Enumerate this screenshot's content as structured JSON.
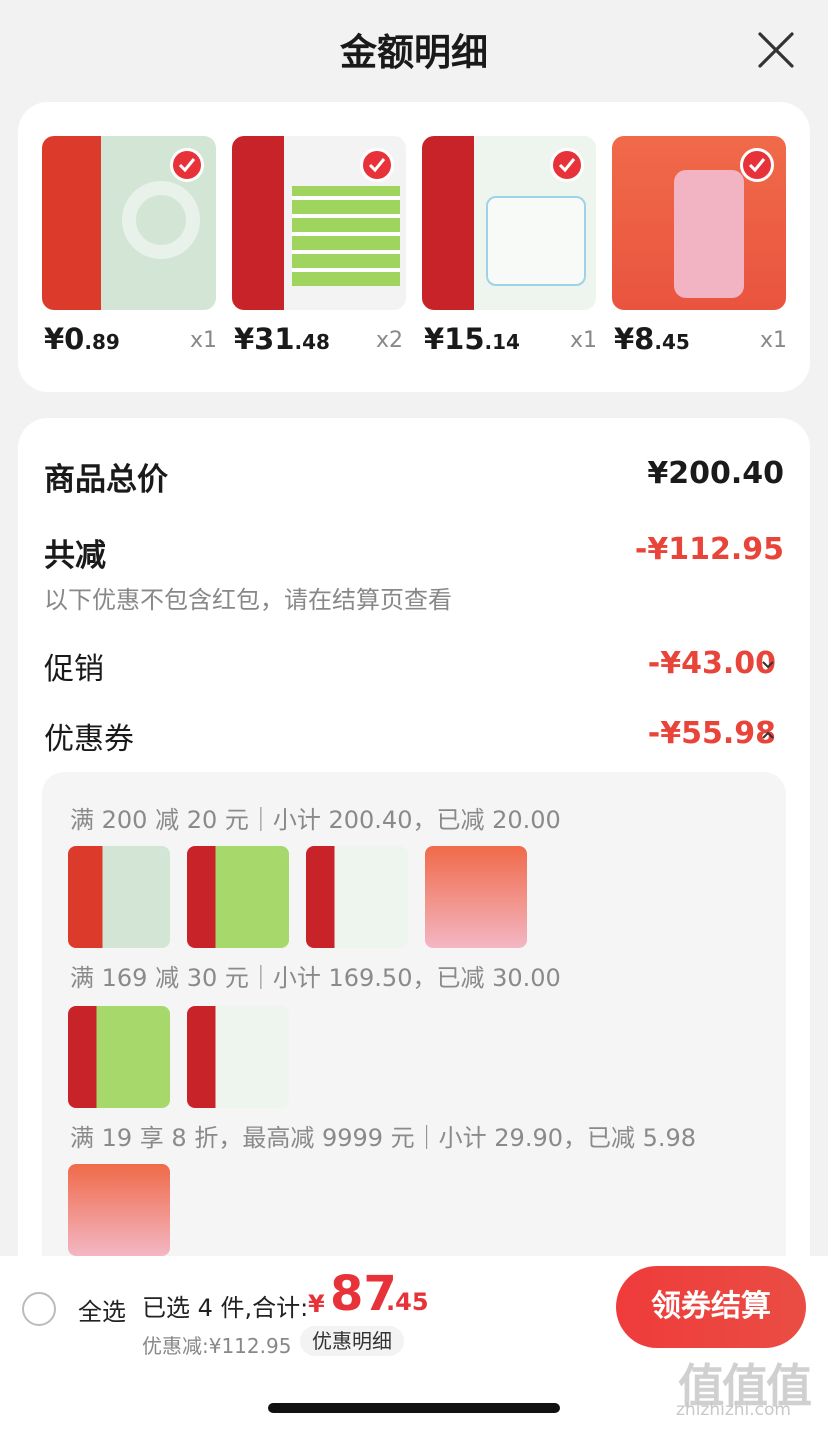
{
  "header": {
    "title": "金额明细"
  },
  "products": [
    {
      "price_int": "¥0",
      "price_dec": ".89",
      "qty": "x1",
      "colors": [
        "#dc3b2b",
        "#cfe3d2"
      ]
    },
    {
      "price_int": "¥31",
      "price_dec": ".48",
      "qty": "x2",
      "colors": [
        "#c9232a",
        "#a6d86b"
      ]
    },
    {
      "price_int": "¥15",
      "price_dec": ".14",
      "qty": "x1",
      "colors": [
        "#c9232a",
        "#eef4ee"
      ]
    },
    {
      "price_int": "¥8",
      "price_dec": ".45",
      "qty": "x1",
      "colors": [
        "#ef6a4a",
        "#f3b7c4"
      ]
    }
  ],
  "summary": {
    "total_label": "商品总价",
    "total_value": "¥200.40",
    "reduced_label": "共减",
    "reduced_value": "-¥112.95",
    "reduced_note": "以下优惠不包含红包，请在结算页查看",
    "promo_label": "促销",
    "promo_value": "-¥43.00",
    "coupon_label": "优惠券",
    "coupon_value": "-¥55.98"
  },
  "coupons": [
    {
      "text": "满 200 减 20 元｜小计 200.40，已减 20.00"
    },
    {
      "text": "满 169 减 30 元｜小计 169.50，已减 30.00"
    },
    {
      "text": "满 19 享 8 折，最高减 9999 元｜小计 29.90，已减 5.98"
    }
  ],
  "footer": {
    "select_all": "全选",
    "selected_info": "已选 4 件,合计:",
    "total_symbol": "¥",
    "total_int": "87",
    "total_dec": ".45",
    "discount": "优惠减:¥112.95",
    "detail_button": "优惠明细",
    "checkout_button": "领券结算"
  },
  "watermark": {
    "logo": "值值值",
    "domain": "zhizhizhi.com"
  },
  "colors": {
    "accent": "#e8443a",
    "checkout": "#ef3b3b"
  }
}
